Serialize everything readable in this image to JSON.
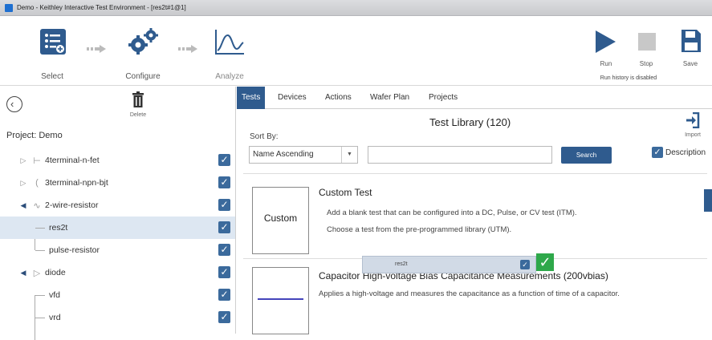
{
  "window": {
    "title": "Demo - Keithley Interactive Test Environment - [res2t#1@1]"
  },
  "toolbar": {
    "select_label": "Select",
    "configure_label": "Configure",
    "analyze_label": "Analyze",
    "run_label": "Run",
    "stop_label": "Stop",
    "save_label": "Save",
    "run_history": "Run history is disabled"
  },
  "left_panel": {
    "delete_label": "Delete",
    "project_label": "Project: Demo",
    "tree": [
      {
        "label": "4terminal-n-fet",
        "checked": true
      },
      {
        "label": "3terminal-npn-bjt",
        "checked": true
      },
      {
        "label": "2-wire-resistor",
        "checked": true
      },
      {
        "label": "res2t",
        "checked": true
      },
      {
        "label": "pulse-resistor",
        "checked": true
      },
      {
        "label": "diode",
        "checked": true
      },
      {
        "label": "vfd",
        "checked": true
      },
      {
        "label": "vrd",
        "checked": true
      }
    ]
  },
  "tabs": [
    "Tests",
    "Devices",
    "Actions",
    "Wafer Plan",
    "Projects"
  ],
  "library": {
    "title": "Test Library (120)",
    "sort_label": "Sort By:",
    "sort_value": "Name Ascending",
    "search_button": "Search",
    "import_label": "Import",
    "description_label": "Description",
    "items": [
      {
        "thumb": "Custom",
        "title": "Custom Test",
        "line1": "Add a blank test that can be configured into a DC, Pulse, or CV test (ITM).",
        "line2": "Choose a test from the pre-programmed library (UTM)."
      },
      {
        "title": "Capacitor High-voltage Bias Capacitance Measurements (200vbias)",
        "line1": "Applies a high-voltage and measures the capacitance as a function of time of a capacitor."
      }
    ]
  },
  "drag_ghost": {
    "label": "res2t"
  },
  "colors": {
    "accent": "#2f5b8e",
    "checkbox": "#3b6a9c",
    "drop_ok": "#2ea84a",
    "selected_row": "#dde7f2"
  }
}
